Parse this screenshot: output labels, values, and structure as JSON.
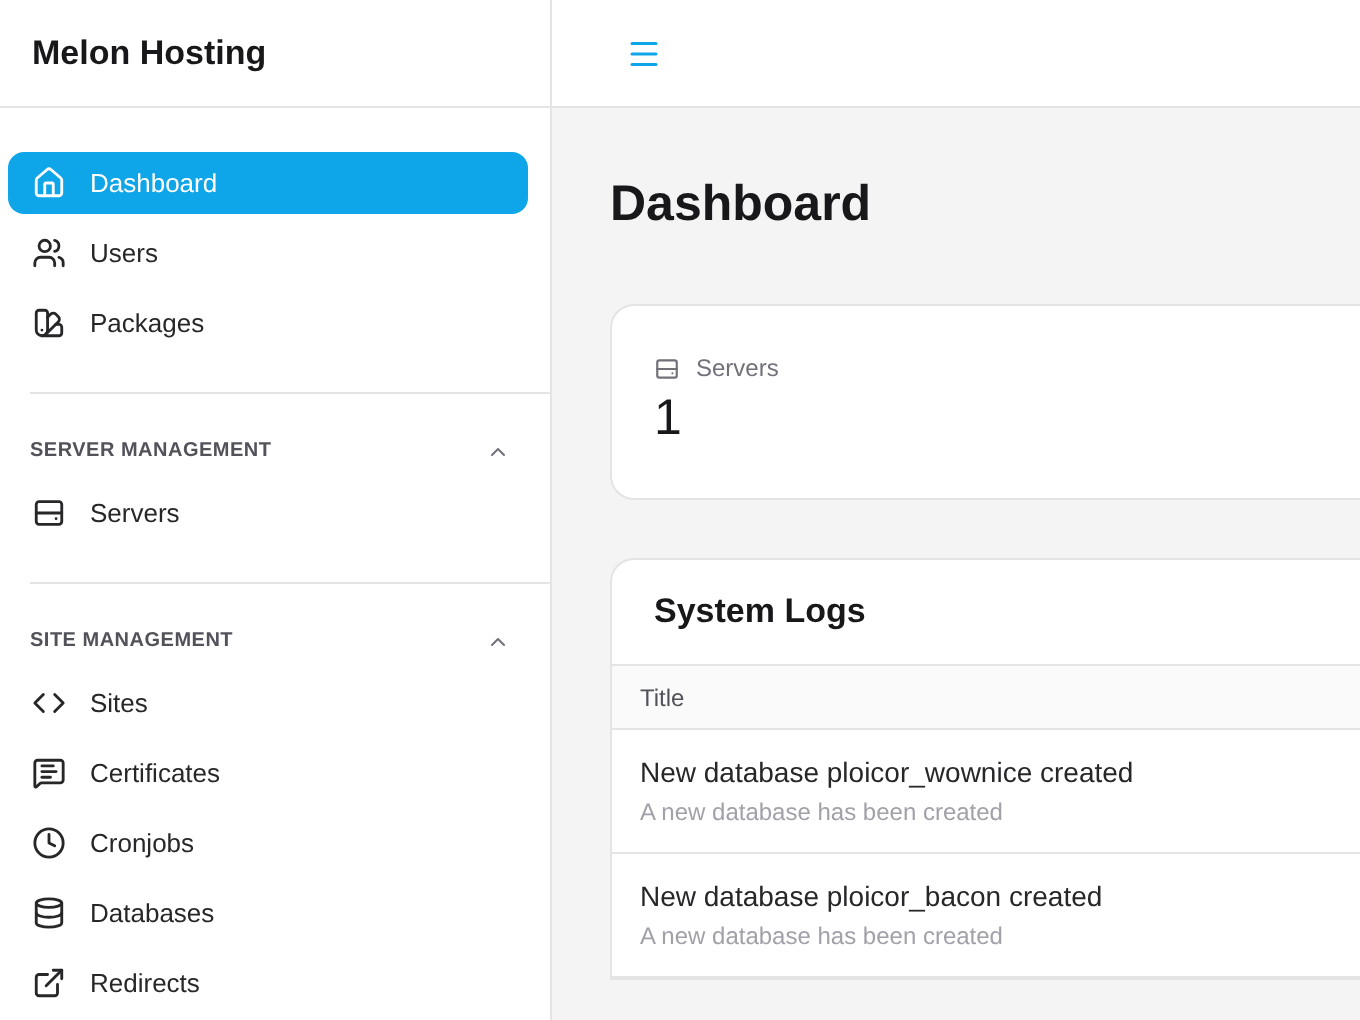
{
  "sidebar": {
    "brand": "Melon Hosting",
    "items": [
      {
        "label": "Dashboard",
        "kind": "home",
        "selected": true
      },
      {
        "label": "Users",
        "kind": "users",
        "selected": false
      },
      {
        "label": "Packages",
        "kind": "swatch",
        "selected": false
      }
    ],
    "sections": [
      {
        "title": "SERVER MANAGEMENT",
        "expanded": true,
        "items": [
          {
            "label": "Servers",
            "kind": "server",
            "selected": false
          }
        ]
      },
      {
        "title": "SITE MANAGEMENT",
        "expanded": true,
        "items": [
          {
            "label": "Sites",
            "kind": "code",
            "selected": false
          },
          {
            "label": "Certificates",
            "kind": "message",
            "selected": false
          },
          {
            "label": "Cronjobs",
            "kind": "clock",
            "selected": false
          },
          {
            "label": "Databases",
            "kind": "database",
            "selected": false
          },
          {
            "label": "Redirects",
            "kind": "external",
            "selected": false
          }
        ]
      }
    ]
  },
  "page": {
    "title": "Dashboard"
  },
  "stats": [
    {
      "label": "Servers",
      "value": "1"
    }
  ],
  "logs": {
    "title": "System Logs",
    "columns": [
      "Title"
    ],
    "rows": [
      {
        "title": "New database ploicor_wownice created",
        "description": "A new database has been created"
      },
      {
        "title": "New database ploicor_bacon created",
        "description": "A new database has been created"
      }
    ]
  }
}
